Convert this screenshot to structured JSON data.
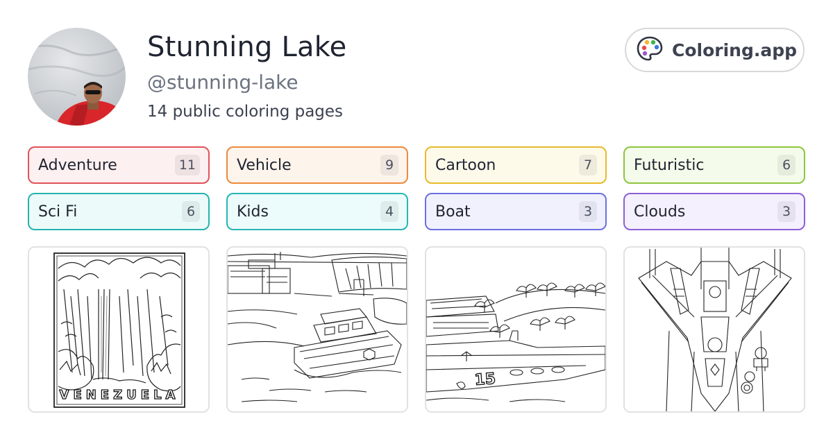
{
  "profile": {
    "name": "Stunning Lake",
    "handle": "@stunning-lake",
    "pages_count": "14 public coloring pages"
  },
  "brand": {
    "label": "Coloring.app",
    "icon": "palette-icon"
  },
  "tags": [
    {
      "label": "Adventure",
      "count": "11",
      "border": "#e0535a",
      "bg": "#fdf0f0"
    },
    {
      "label": "Vehicle",
      "count": "9",
      "border": "#ec8a3c",
      "bg": "#fdf4ec"
    },
    {
      "label": "Cartoon",
      "count": "7",
      "border": "#e8b92a",
      "bg": "#fdfaea"
    },
    {
      "label": "Futuristic",
      "count": "6",
      "border": "#8cc63f",
      "bg": "#f4fbea"
    },
    {
      "label": "Sci Fi",
      "count": "6",
      "border": "#25b3b0",
      "bg": "#ecfafa"
    },
    {
      "label": "Kids",
      "count": "4",
      "border": "#27b5b5",
      "bg": "#ecfbfb"
    },
    {
      "label": "Boat",
      "count": "3",
      "border": "#6b6fe0",
      "bg": "#f0f1fd"
    },
    {
      "label": "Clouds",
      "count": "3",
      "border": "#8b5fd6",
      "bg": "#f5f0fd"
    }
  ],
  "gallery": [
    {
      "name": "waterfall-coloring-page",
      "caption": "VENEZUELA"
    },
    {
      "name": "boat-harbor-coloring-page"
    },
    {
      "name": "yacht-river-coloring-page",
      "hull_number": "15"
    },
    {
      "name": "spaceship-coloring-page"
    }
  ]
}
